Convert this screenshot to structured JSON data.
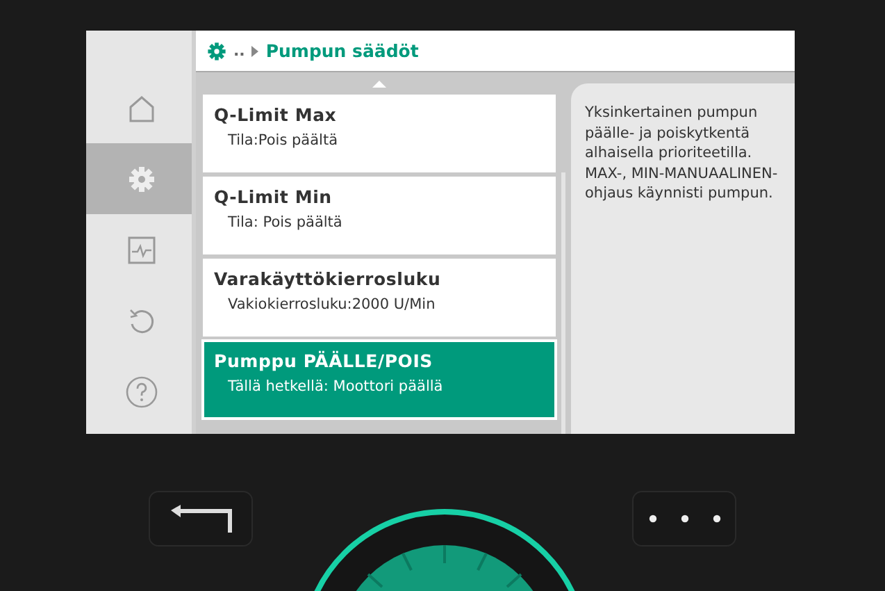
{
  "sidebar": {
    "items": [
      {
        "kind": "home",
        "selected": false
      },
      {
        "kind": "settings",
        "selected": true
      },
      {
        "kind": "diagnostics",
        "selected": false
      },
      {
        "kind": "restore",
        "selected": false
      },
      {
        "kind": "help",
        "selected": false
      }
    ]
  },
  "header": {
    "breadcrumb": "..",
    "title": "Pumpun säädöt"
  },
  "menu": {
    "items": [
      {
        "title": "Q-Limit Max",
        "subtitle": "Tila:Pois päältä",
        "selected": false
      },
      {
        "title": "Q-Limit Min",
        "subtitle": "Tila: Pois päältä",
        "selected": false
      },
      {
        "title": "Varakäyttökierrosluku",
        "subtitle": "Vakiokierrosluku:2000 U/Min",
        "selected": false
      },
      {
        "title": "Pumppu PÄÄLLE/POIS",
        "subtitle": "Tällä hetkellä: Moottori päällä",
        "selected": true
      }
    ]
  },
  "info": {
    "text": "Yksinkertainen pumpun päälle- ja poiskytkentä alhaisella prioriteetilla. MAX-, MIN-MANUAALINEN-ohjaus käynnisti pumpun."
  }
}
